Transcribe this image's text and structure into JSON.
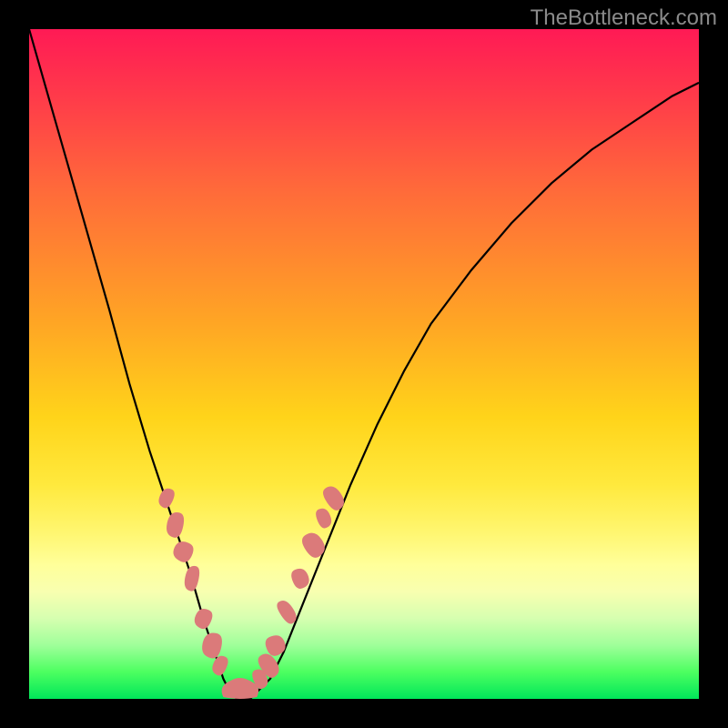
{
  "watermark": "TheBottleneck.com",
  "colors": {
    "background": "#000000",
    "blob": "#db7a7a",
    "curve": "#000000",
    "gradient_stops": [
      "#ff1a55",
      "#ff3a4a",
      "#ff6a3a",
      "#ffa624",
      "#ffd41a",
      "#ffe93d",
      "#fff66f",
      "#ffff9a",
      "#f8ffb0",
      "#d6ffb0",
      "#9fff9a",
      "#4cff60",
      "#00e65a"
    ]
  },
  "chart_data": {
    "type": "line",
    "title": "",
    "xlabel": "",
    "ylabel": "",
    "xlim": [
      0,
      100
    ],
    "ylim": [
      0,
      100
    ],
    "grid": false,
    "x": [
      0,
      4,
      8,
      12,
      15,
      18,
      21,
      24,
      26,
      28,
      29,
      30,
      31,
      32,
      33,
      34,
      36,
      38,
      40,
      44,
      48,
      52,
      56,
      60,
      66,
      72,
      78,
      84,
      90,
      96,
      100
    ],
    "values": [
      100,
      86,
      72,
      58,
      47,
      37,
      28,
      19,
      12,
      6,
      3,
      1,
      0,
      0,
      0,
      1,
      3,
      7,
      12,
      22,
      32,
      41,
      49,
      56,
      64,
      71,
      77,
      82,
      86,
      90,
      92
    ],
    "annotations_left": [
      {
        "x": 20.5,
        "y": 30
      },
      {
        "x": 21.8,
        "y": 26
      },
      {
        "x": 23.0,
        "y": 22
      },
      {
        "x": 24.3,
        "y": 18
      },
      {
        "x": 26.0,
        "y": 12
      },
      {
        "x": 27.3,
        "y": 8
      },
      {
        "x": 28.5,
        "y": 5
      }
    ],
    "annotations_right": [
      {
        "x": 34.5,
        "y": 3
      },
      {
        "x": 35.8,
        "y": 5
      },
      {
        "x": 36.8,
        "y": 8
      },
      {
        "x": 38.5,
        "y": 13
      },
      {
        "x": 40.5,
        "y": 18
      },
      {
        "x": 42.5,
        "y": 23
      },
      {
        "x": 44.0,
        "y": 27
      },
      {
        "x": 45.5,
        "y": 30
      }
    ],
    "bottom_lobe": {
      "x_start": 29,
      "x_end": 34,
      "y": 0
    }
  }
}
